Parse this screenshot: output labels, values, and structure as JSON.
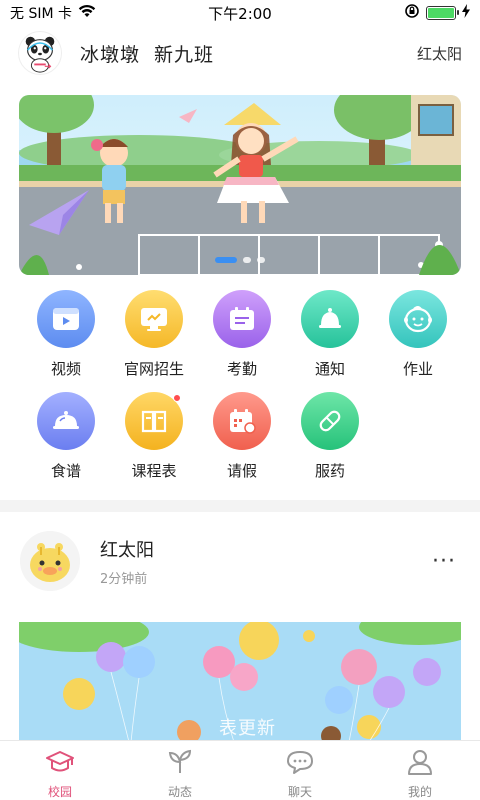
{
  "status_bar": {
    "carrier": "无 SIM 卡",
    "time": "下午2:00",
    "battery_level": 1.0
  },
  "header": {
    "school": "冰墩墩",
    "class_name": "新九班",
    "user": "红太阳"
  },
  "banner": {
    "slide_count": 3,
    "active_slide": 1
  },
  "menu": {
    "row1": [
      {
        "label": "视频",
        "icon": "video-icon",
        "color": "#6f9cf4"
      },
      {
        "label": "官网招生",
        "icon": "monitor-icon",
        "color": "#f7c948"
      },
      {
        "label": "考勤",
        "icon": "attendance-icon",
        "color": "#b07ef0"
      },
      {
        "label": "通知",
        "icon": "bell-icon",
        "color": "#3fd0b0"
      },
      {
        "label": "作业",
        "icon": "baby-face-icon",
        "color": "#4fd1c8"
      }
    ],
    "row2": [
      {
        "label": "食谱",
        "icon": "dish-icon",
        "color": "#7f8ff6"
      },
      {
        "label": "课程表",
        "icon": "book-icon",
        "color": "#f7c340"
      },
      {
        "label": "请假",
        "icon": "calendar-icon",
        "color": "#f57a6c"
      },
      {
        "label": "服药",
        "icon": "pill-icon",
        "color": "#3ed68e"
      }
    ]
  },
  "post": {
    "author": "红太阳",
    "time": "2分钟前",
    "more": "···",
    "image_caption": "表更新"
  },
  "tabs": [
    {
      "label": "校园",
      "icon": "graduation-cap-icon",
      "active": true
    },
    {
      "label": "动态",
      "icon": "sprout-icon",
      "active": false
    },
    {
      "label": "聊天",
      "icon": "chat-bubble-icon",
      "active": false
    },
    {
      "label": "我的",
      "icon": "person-icon",
      "active": false
    }
  ],
  "colors": {
    "accent": "#e0527a",
    "dot_active": "#3a8ff2",
    "divider": "#f3f3f3"
  }
}
